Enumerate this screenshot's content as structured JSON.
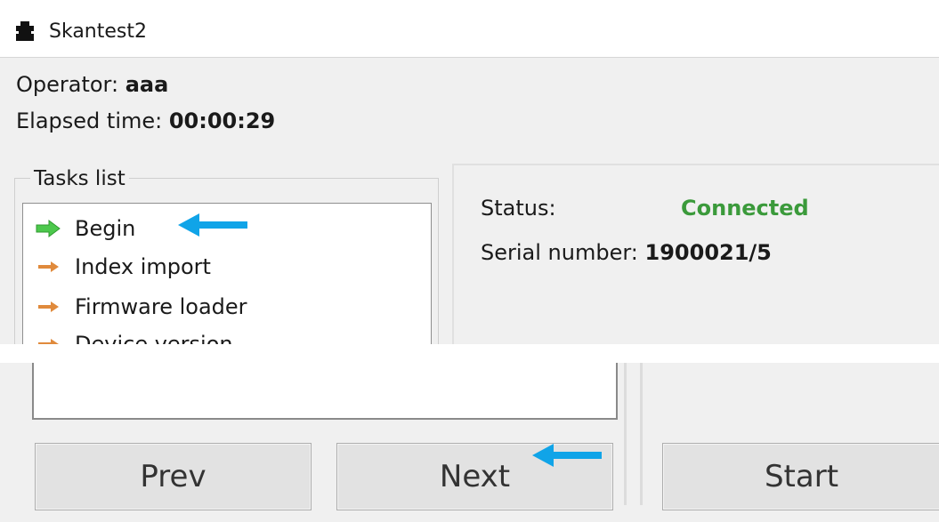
{
  "window": {
    "title": "Skantest2",
    "app_icon": "puzzle-icon"
  },
  "info": {
    "operator_label": "Operator:",
    "operator_value": "aaa",
    "elapsed_label": "Elapsed time:",
    "elapsed_value": "00:00:29"
  },
  "tasks": {
    "group_label": "Tasks list",
    "items": [
      {
        "label": "Begin",
        "icon": "green-arrow-icon",
        "state": "current"
      },
      {
        "label": "Index import",
        "icon": "orange-arrow-icon",
        "state": "pending"
      },
      {
        "label": "Firmware loader",
        "icon": "orange-arrow-icon",
        "state": "pending"
      },
      {
        "label": "Device version",
        "icon": "orange-arrow-icon",
        "state": "pending"
      }
    ]
  },
  "status": {
    "status_label": "Status:",
    "status_value": "Connected",
    "status_color": "#3b9a3b",
    "serial_label": "Serial number:",
    "serial_value": "1900021/5"
  },
  "buttons": {
    "prev": "Prev",
    "next": "Next",
    "start": "Start"
  },
  "annotations": {
    "arrow_color": "#10a4e8"
  },
  "colors": {
    "current_arrow": "#4cc84c",
    "pending_arrow": "#e08a3c"
  }
}
